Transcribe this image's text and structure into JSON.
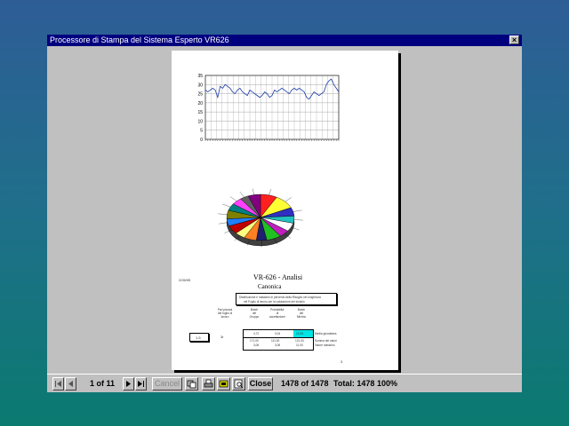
{
  "window": {
    "title": "Processore di Stampa del Sistema Esperto VR626",
    "close_glyph": "×"
  },
  "report": {
    "footer_left": "2/26/95",
    "heading": "VR-626 - Analisi",
    "subheading": "Canonica",
    "boxed_text_line1": "Distribuzione e massimo in percento della Risoglio nei lunghezza",
    "boxed_text_line2": "nel Foglio di lavoro per la valutazione del sinobio",
    "col_headers": [
      [
        "Pari pizzaol",
        "del foglio di",
        "lavoro"
      ],
      [
        "Batch",
        "del",
        "Gruppo"
      ],
      [
        "Probabilita'",
        "di",
        "accettazione"
      ],
      [
        "Batch",
        "del",
        "Minimo"
      ]
    ],
    "row_box_value": "1.5",
    "row_value_2": "3r",
    "table_rows": [
      [
        "4,72",
        "0,04",
        "12,25",
        "Media giornaliera"
      ],
      [
        "171,00",
        "111,00",
        "121,00",
        "Somma dei valori"
      ],
      [
        "3,06",
        "3,06",
        "11,00",
        "Valore massimo"
      ]
    ],
    "page_marker": "3"
  },
  "chart_data": [
    {
      "type": "line",
      "y_ticks": [
        "0",
        "5",
        "10",
        "15",
        "20",
        "25",
        "30",
        "35"
      ],
      "ylim": [
        0,
        35
      ],
      "grid": true,
      "values": [
        27,
        26,
        27,
        28,
        27,
        23,
        29,
        28,
        30,
        29,
        28,
        26,
        25,
        27,
        28,
        26,
        25,
        24,
        27,
        26,
        25,
        24,
        23,
        24,
        26,
        25,
        23,
        24,
        27,
        26,
        27,
        28,
        27,
        26,
        25,
        27,
        28,
        27,
        28,
        27,
        26,
        23,
        22,
        24,
        26,
        25,
        24,
        25,
        26,
        30,
        32,
        33,
        30,
        28,
        26
      ]
    },
    {
      "type": "pie",
      "slices": [
        {
          "value": 8,
          "color": "#ff2020"
        },
        {
          "value": 10,
          "color": "#ffff33"
        },
        {
          "value": 6,
          "color": "#3030c0"
        },
        {
          "value": 5,
          "color": "#22c0c0"
        },
        {
          "value": 6,
          "color": "#ffffff"
        },
        {
          "value": 5,
          "color": "#c020c0"
        },
        {
          "value": 7,
          "color": "#20c020"
        },
        {
          "value": 5,
          "color": "#202070"
        },
        {
          "value": 6,
          "color": "#ff8020"
        },
        {
          "value": 5,
          "color": "#ffff80"
        },
        {
          "value": 6,
          "color": "#c00000"
        },
        {
          "value": 5,
          "color": "#2080ff"
        },
        {
          "value": 6,
          "color": "#808000"
        },
        {
          "value": 5,
          "color": "#008080"
        },
        {
          "value": 5,
          "color": "#ff40ff"
        },
        {
          "value": 4,
          "color": "#606060"
        },
        {
          "value": 6,
          "color": "#800080"
        }
      ]
    }
  ],
  "statusbar": {
    "page_indicator": "1 of 11",
    "cancel_label": "Cancel",
    "close_label": "Close",
    "record_counter": "1478 of 1478",
    "total_label": "Total: 1478",
    "zoom": "100%",
    "icons": [
      "first-page-icon",
      "prev-page-icon",
      "next-page-icon",
      "last-page-icon",
      "export-icon",
      "print-icon",
      "print-setup-icon",
      "search-text-icon"
    ]
  }
}
